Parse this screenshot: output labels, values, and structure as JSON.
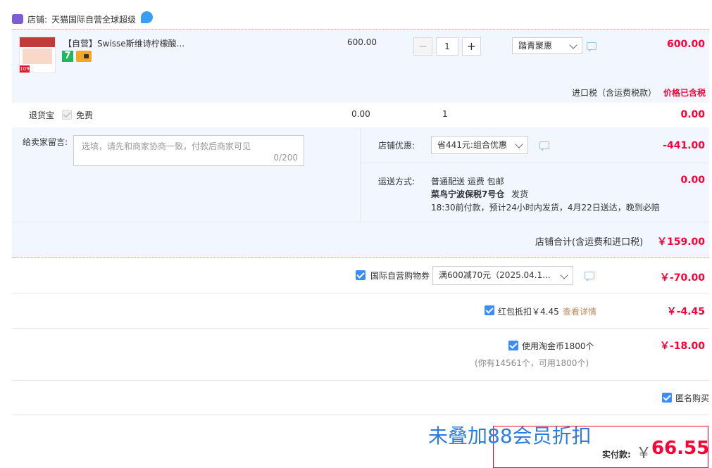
{
  "shop": {
    "label": "店铺:",
    "name": "天猫国际自营全球超级"
  },
  "product": {
    "title": "【自营】Swisse斯维诗柠檬酸...",
    "unit_price": "600.00",
    "quantity": "1",
    "promo_select": "踏青聚惠",
    "subtotal": "600.00",
    "badge_number": "7",
    "thumb_tag": "109"
  },
  "tax": {
    "label": "进口税（含运费税款）",
    "status": "价格已含税"
  },
  "return_insurance": {
    "label": "退货宝",
    "option": "免费",
    "price": "0.00",
    "quantity": "1",
    "total": "0.00"
  },
  "message": {
    "label": "给卖家留言:",
    "placeholder": "选填，请先和商家协商一致，付款后商家可见",
    "counter": "0/200"
  },
  "shop_discount": {
    "label": "店铺优惠:",
    "select": "省441元:组合优惠",
    "amount": "-441.00"
  },
  "shipping": {
    "label": "运送方式:",
    "method": "普通配送 运费 包邮",
    "warehouse": "菜鸟宁波保税7号仓",
    "ship_word": "发货",
    "note": "18:30前付款，预计24小时内发货，4月22日送达，晚到必赔",
    "fee": "0.00"
  },
  "shop_total": {
    "label": "店铺合计(含运费和进口税)",
    "amount": "￥159.00"
  },
  "coupon": {
    "label": "国际自营购物券",
    "select": "满600减70元（2025.04.1...",
    "amount": "￥-70.00"
  },
  "red_packet": {
    "label": "红包抵扣￥4.45",
    "link": "查看详情",
    "amount": "￥-4.45"
  },
  "taojinbi": {
    "label": "使用淘金币1800个",
    "note": "(你有14561个，可用1800个)",
    "amount": "￥-18.00"
  },
  "anonymous": {
    "label": "匿名购买"
  },
  "overlay_text": "未叠加88会员折扣",
  "payment": {
    "label": "实付款:",
    "currency": "￥",
    "amount": "66.55"
  },
  "colors": {
    "accent": "#ff0036",
    "blue": "#3b8cff",
    "panel": "#f2f7ff"
  }
}
